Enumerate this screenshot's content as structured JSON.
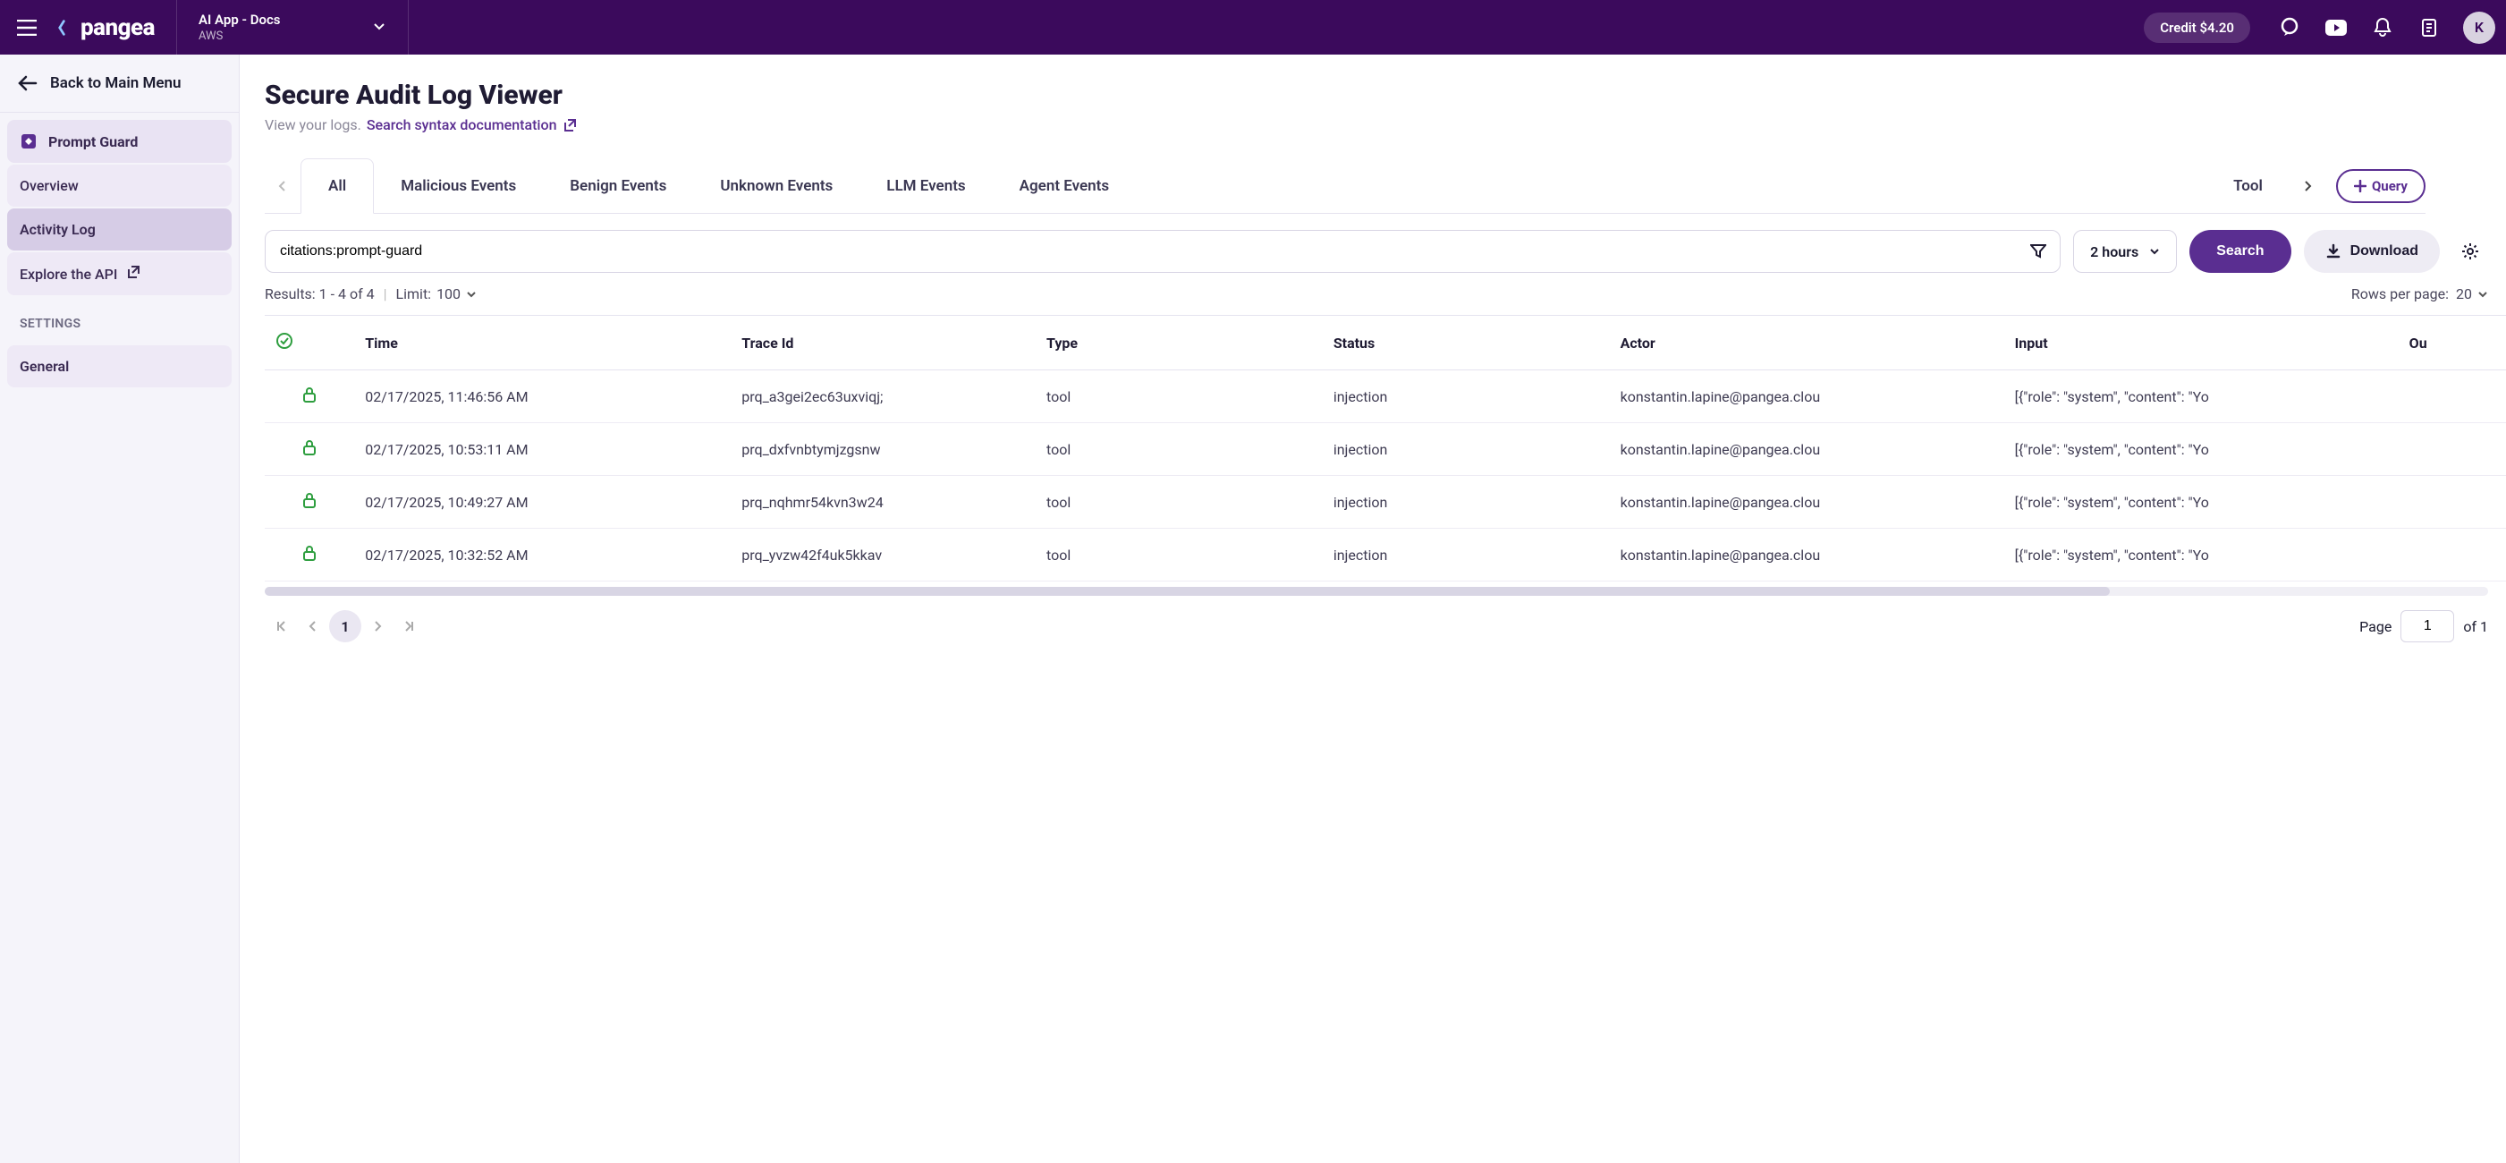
{
  "topbar": {
    "app_name": "AI App - Docs",
    "app_provider": "AWS",
    "credit_label": "Credit $4.20",
    "avatar_initial": "K"
  },
  "sidebar": {
    "back_label": "Back to Main Menu",
    "section": "Prompt Guard",
    "items": [
      {
        "label": "Overview"
      },
      {
        "label": "Activity Log"
      },
      {
        "label": "Explore the API"
      }
    ],
    "settings_header": "SETTINGS",
    "settings_item": "General"
  },
  "page": {
    "title": "Secure Audit Log Viewer",
    "subtitle_prefix": "View your logs.",
    "doc_link": "Search syntax documentation"
  },
  "tabs": {
    "items": [
      "All",
      "Malicious Events",
      "Benign Events",
      "Unknown Events",
      "LLM Events",
      "Agent Events",
      "Tool"
    ],
    "query_label": "Query"
  },
  "search": {
    "value": "citations:prompt-guard",
    "time_range": "2 hours",
    "search_label": "Search",
    "download_label": "Download"
  },
  "results": {
    "label": "Results: 1 - 4 of 4",
    "limit_label": "Limit:",
    "limit_value": "100",
    "rows_label": "Rows per page:",
    "rows_value": "20"
  },
  "table": {
    "columns": [
      "Time",
      "Trace Id",
      "Type",
      "Status",
      "Actor",
      "Input",
      "Ou"
    ],
    "rows": [
      {
        "time": "02/17/2025, 11:46:56 AM",
        "trace": "prq_a3gei2ec63uxviqj;",
        "type": "tool",
        "status": "injection",
        "actor": "konstantin.lapine@pangea.clou",
        "input": "[{\"role\": \"system\", \"content\": \"Yo"
      },
      {
        "time": "02/17/2025, 10:53:11 AM",
        "trace": "prq_dxfvnbtymjzgsnw",
        "type": "tool",
        "status": "injection",
        "actor": "konstantin.lapine@pangea.clou",
        "input": "[{\"role\": \"system\", \"content\": \"Yo"
      },
      {
        "time": "02/17/2025, 10:49:27 AM",
        "trace": "prq_nqhmr54kvn3w24",
        "type": "tool",
        "status": "injection",
        "actor": "konstantin.lapine@pangea.clou",
        "input": "[{\"role\": \"system\", \"content\": \"Yo"
      },
      {
        "time": "02/17/2025, 10:32:52 AM",
        "trace": "prq_yvzw42f4uk5kkav",
        "type": "tool",
        "status": "injection",
        "actor": "konstantin.lapine@pangea.clou",
        "input": "[{\"role\": \"system\", \"content\": \"Yo"
      }
    ]
  },
  "pagination": {
    "current": "1",
    "page_label": "Page",
    "page_input": "1",
    "of_label": "of 1"
  }
}
